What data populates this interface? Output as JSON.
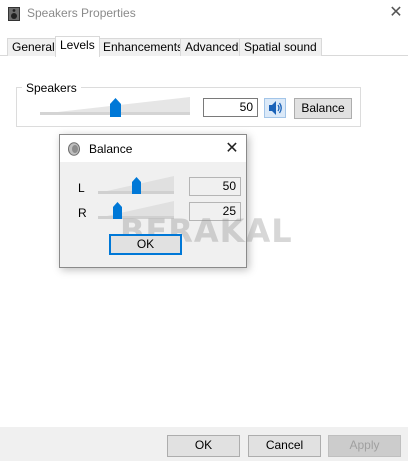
{
  "window": {
    "title": "Speakers Properties"
  },
  "tabs": [
    {
      "label": "General"
    },
    {
      "label": "Levels",
      "active": true
    },
    {
      "label": "Enhancements"
    },
    {
      "label": "Advanced"
    },
    {
      "label": "Spatial sound"
    }
  ],
  "speakers": {
    "group_label": "Speakers",
    "volume": "50",
    "volume_fraction": 0.5,
    "balance_button": "Balance",
    "speaker_icon": "speaker-icon"
  },
  "balance_dialog": {
    "title": "Balance",
    "left_label": "L",
    "left_value": "50",
    "left_fraction": 0.5,
    "right_label": "R",
    "right_value": "25",
    "right_fraction": 0.25,
    "ok_button": "OK"
  },
  "watermark": "BERAKAL",
  "footer": {
    "ok": "OK",
    "cancel": "Cancel",
    "apply": "Apply"
  },
  "colors": {
    "accent": "#0078d7",
    "disabled_text": "#a0a0a0"
  }
}
